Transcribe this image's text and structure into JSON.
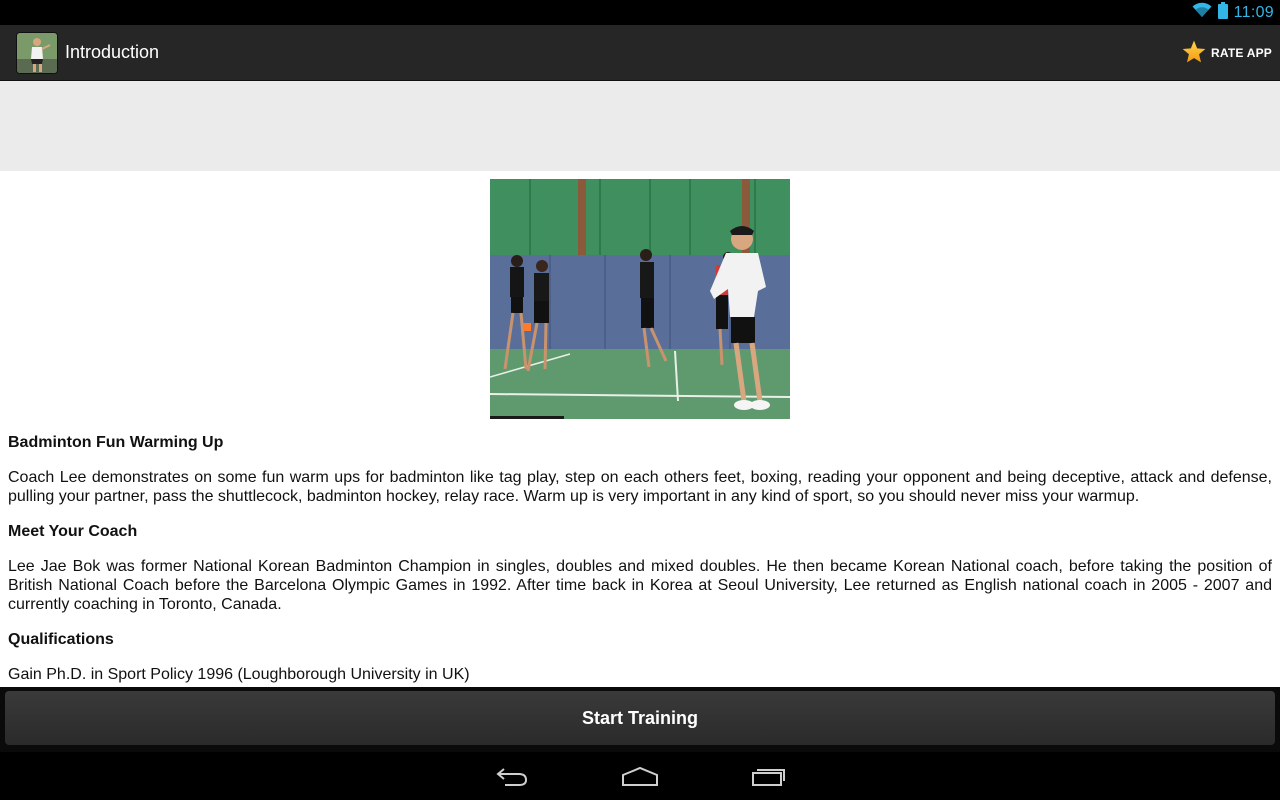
{
  "status_bar": {
    "time": "11:09",
    "icons": [
      "wifi-icon",
      "battery-icon"
    ]
  },
  "action_bar": {
    "title": "Introduction",
    "rate_label": "RATE APP",
    "app_icon": "badminton-player-icon",
    "rate_icon": "star-icon"
  },
  "video": {
    "thumbnail": "badminton-warmup-video-thumbnail"
  },
  "sections": [
    {
      "heading": "Badminton Fun Warming Up",
      "body": "Coach Lee demonstrates on some fun warm ups for badminton like tag play, step on each others feet, boxing, reading your opponent and being deceptive, attack and defense, pulling your partner, pass the shuttlecock, badminton hockey, relay race. Warm up is very important in any kind of sport, so you should never miss your warmup."
    },
    {
      "heading": "Meet Your Coach",
      "body": "Lee Jae Bok was former National Korean Badminton Champion in singles, doubles and mixed doubles. He then became Korean National coach, before taking the position of British National Coach before the Barcelona Olympic Games in 1992. After time back in Korea at Seoul University, Lee returned as English national coach in 2005 - 2007 and currently coaching in Toronto, Canada."
    },
    {
      "heading": "Qualifications",
      "body": "Gain Ph.D. in Sport Policy 1996 (Loughborough University in UK)"
    }
  ],
  "bottom": {
    "start_label": "Start Training"
  },
  "nav_bar": {
    "icons": [
      "back-icon",
      "home-icon",
      "recent-apps-icon"
    ]
  },
  "colors": {
    "status_accent": "#33b5e5",
    "action_bar_bg": "#262626",
    "ad_bg": "#ebebeb"
  }
}
